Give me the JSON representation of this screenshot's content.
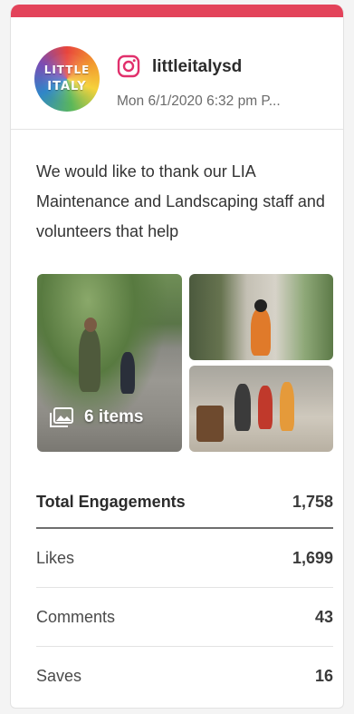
{
  "post": {
    "handle": "littleitalysd",
    "timestamp": "Mon 6/1/2020 6:32 pm P...",
    "caption": "We would like to thank our LIA Maintenance and Landscaping staff and volunteers that help",
    "avatar_text_line1": "LITTLE",
    "avatar_text_line2": "ITALY",
    "media_items_label": "6 items"
  },
  "stats": [
    {
      "label": "Total Engagements",
      "value": "1,758"
    },
    {
      "label": "Likes",
      "value": "1,699"
    },
    {
      "label": "Comments",
      "value": "43"
    },
    {
      "label": "Saves",
      "value": "16"
    }
  ],
  "icons": {
    "platform": "instagram-icon",
    "media": "gallery-icon"
  },
  "colors": {
    "accent": "#e3435a",
    "instagram": "#e1306c"
  }
}
